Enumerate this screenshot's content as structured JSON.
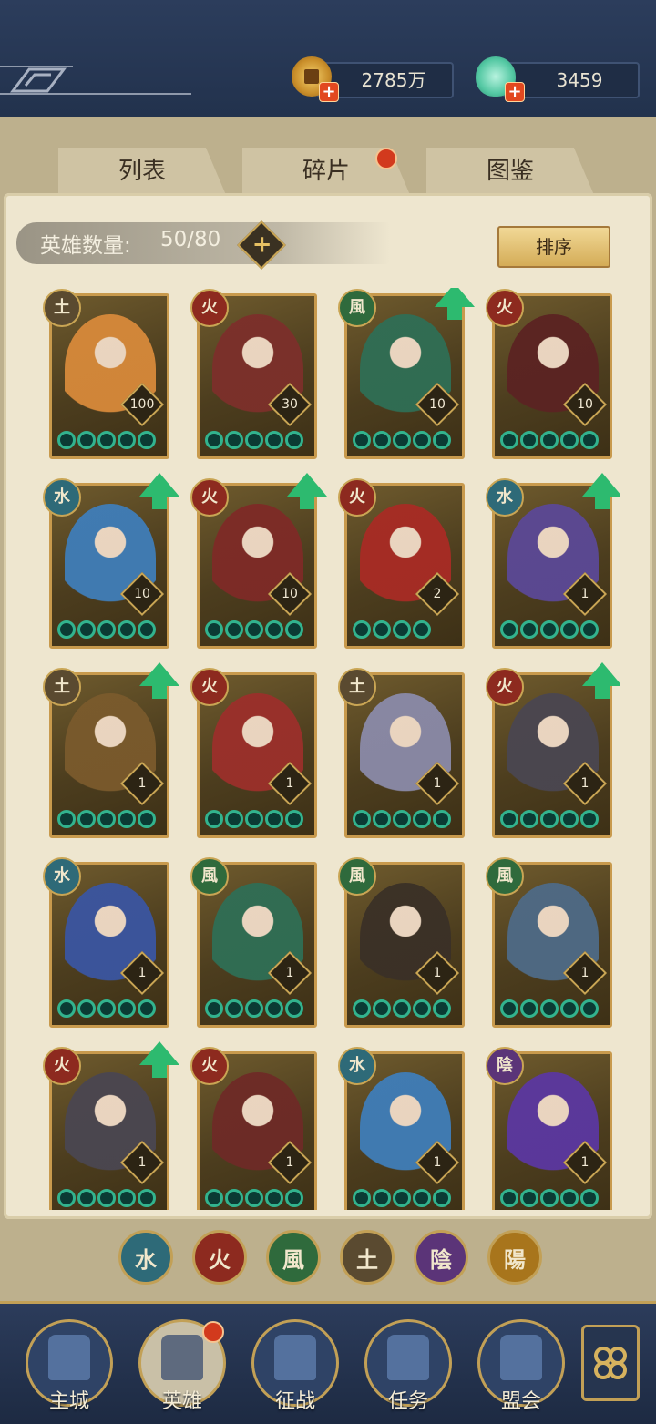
{
  "resources": {
    "coins": {
      "value": "2785万",
      "icon": "coin-icon"
    },
    "jade": {
      "value": "3459",
      "icon": "jade-icon"
    }
  },
  "tabs": [
    {
      "label": "列表",
      "active": true
    },
    {
      "label": "碎片",
      "active": false,
      "badge": true
    },
    {
      "label": "图鉴",
      "active": false
    }
  ],
  "hero_count": {
    "label": "英雄数量:",
    "value": "50/80"
  },
  "sort_label": "排序",
  "elements": {
    "water": {
      "glyph": "水",
      "color": "#2e6a78"
    },
    "fire": {
      "glyph": "火",
      "color": "#8d2a1f"
    },
    "wind": {
      "glyph": "風",
      "color": "#2f6a3c"
    },
    "earth": {
      "glyph": "土",
      "color": "#5a4a30"
    },
    "yin": {
      "glyph": "陰",
      "color": "#5b3478"
    },
    "yang": {
      "glyph": "陽",
      "color": "#a8751c"
    }
  },
  "heroes": [
    {
      "element": "earth",
      "level": "100",
      "stars": 5,
      "upgrade": false,
      "portrait": "#d7893a"
    },
    {
      "element": "fire",
      "level": "30",
      "stars": 5,
      "upgrade": false,
      "portrait": "#7c2f2a"
    },
    {
      "element": "wind",
      "level": "10",
      "stars": 5,
      "upgrade": true,
      "portrait": "#2f6e55"
    },
    {
      "element": "fire",
      "level": "10",
      "stars": 5,
      "upgrade": false,
      "portrait": "#5b2322"
    },
    {
      "element": "water",
      "level": "10",
      "stars": 5,
      "upgrade": true,
      "portrait": "#3f7db8"
    },
    {
      "element": "fire",
      "level": "10",
      "stars": 5,
      "upgrade": true,
      "portrait": "#7e2a26"
    },
    {
      "element": "fire",
      "level": "2",
      "stars": 4,
      "upgrade": false,
      "portrait": "#a82b24"
    },
    {
      "element": "water",
      "level": "1",
      "stars": 5,
      "upgrade": true,
      "portrait": "#5b4896"
    },
    {
      "element": "earth",
      "level": "1",
      "stars": 5,
      "upgrade": true,
      "portrait": "#7a5a2c"
    },
    {
      "element": "fire",
      "level": "1",
      "stars": 5,
      "upgrade": false,
      "portrait": "#9b2f2a"
    },
    {
      "element": "earth",
      "level": "1",
      "stars": 5,
      "upgrade": false,
      "portrait": "#8a8aa8"
    },
    {
      "element": "fire",
      "level": "1",
      "stars": 5,
      "upgrade": true,
      "portrait": "#4a4650"
    },
    {
      "element": "water",
      "level": "1",
      "stars": 5,
      "upgrade": false,
      "portrait": "#3a55a0"
    },
    {
      "element": "wind",
      "level": "1",
      "stars": 5,
      "upgrade": false,
      "portrait": "#2f6e55"
    },
    {
      "element": "wind",
      "level": "1",
      "stars": 5,
      "upgrade": false,
      "portrait": "#3a3026"
    },
    {
      "element": "wind",
      "level": "1",
      "stars": 5,
      "upgrade": false,
      "portrait": "#4e6a86"
    },
    {
      "element": "fire",
      "level": "1",
      "stars": 5,
      "upgrade": true,
      "portrait": "#4a4650"
    },
    {
      "element": "fire",
      "level": "1",
      "stars": 5,
      "upgrade": false,
      "portrait": "#6e2a26"
    },
    {
      "element": "water",
      "level": "1",
      "stars": 5,
      "upgrade": false,
      "portrait": "#3f7db8"
    },
    {
      "element": "yin",
      "level": "1",
      "stars": 5,
      "upgrade": false,
      "portrait": "#5b37a0"
    }
  ],
  "filters": [
    "water",
    "fire",
    "wind",
    "earth",
    "yin",
    "yang"
  ],
  "nav": [
    {
      "label": "主城",
      "icon": "palace-icon",
      "active": false
    },
    {
      "label": "英雄",
      "icon": "hero-icon",
      "active": true,
      "badge": true
    },
    {
      "label": "征战",
      "icon": "drum-icon",
      "active": false
    },
    {
      "label": "任务",
      "icon": "scroll-icon",
      "active": false
    },
    {
      "label": "盟会",
      "icon": "pavilion-icon",
      "active": false
    }
  ],
  "more_icon": "flower-menu-icon"
}
